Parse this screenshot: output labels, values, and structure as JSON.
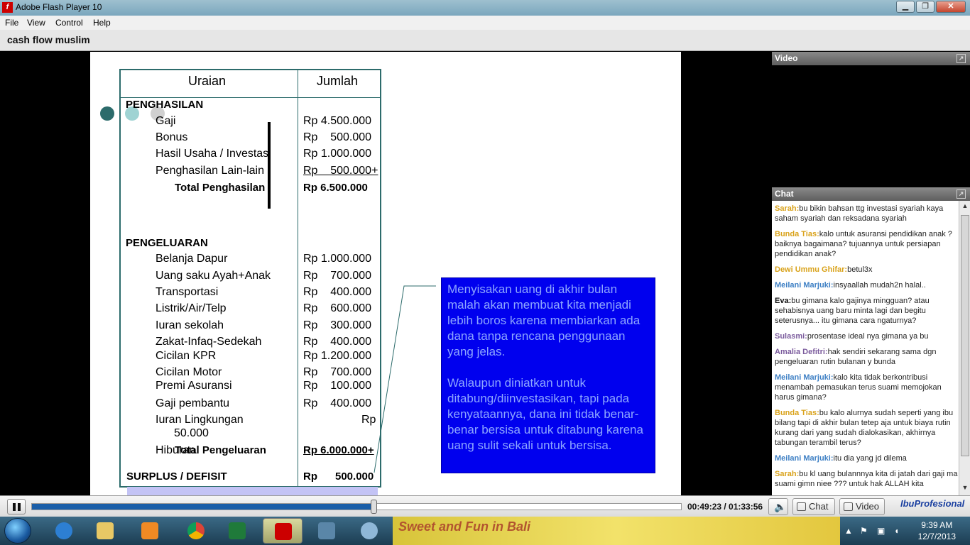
{
  "window": {
    "title": "Adobe Flash Player 10",
    "min": "▁",
    "max": "❐",
    "close": "✕"
  },
  "menu": [
    "File",
    "View",
    "Control",
    "Help"
  ],
  "app_title": "cash flow muslim",
  "table": {
    "head_uraian": "Uraian",
    "head_jumlah": "Jumlah",
    "income_header": "PENGHASILAN",
    "income": [
      {
        "label": "Gaji",
        "amount": "Rp 4.500.000"
      },
      {
        "label": "Bonus",
        "amount": "Rp    500.000"
      },
      {
        "label": "Hasil Usaha / Investasi",
        "amount": "Rp 1.000.000"
      },
      {
        "label": "Penghasilan Lain-lain",
        "amount": "Rp    500.000+"
      }
    ],
    "income_total_label": "Total Penghasilan",
    "income_total_amount": "Rp 6.500.000",
    "expense_header": "PENGELUARAN",
    "expenses": [
      {
        "label": "Belanja Dapur",
        "amount": "Rp 1.000.000"
      },
      {
        "label": "Uang saku Ayah+Anak",
        "amount": "Rp    700.000"
      },
      {
        "label": "Transportasi",
        "amount": "Rp    400.000"
      },
      {
        "label": "Listrik/Air/Telp",
        "amount": "Rp    600.000"
      },
      {
        "label": "Iuran sekolah",
        "amount": "Rp    300.000"
      },
      {
        "label": "Zakat-Infaq-Sedekah",
        "amount": "Rp    400.000"
      },
      {
        "label": "Cicilan KPR",
        "amount": "Rp 1.200.000"
      },
      {
        "label": "Cicilan Motor",
        "amount": "Rp    700.000"
      },
      {
        "label": "Premi Asuransi",
        "amount": "Rp    100.000"
      },
      {
        "label": "Gaji pembantu",
        "amount": "Rp    400.000"
      }
    ],
    "iuran_label": "Iuran Lingkungan",
    "iuran_amount": "Rp",
    "iuran_amount2": "50.000",
    "hiburan_label": "Hiburan",
    "expense_total_label": "Total Pengeluaran",
    "expense_total_amount": "Rp 6.000.000+",
    "surplus_label": "SURPLUS / DEFISIT",
    "surplus_amount": "Rp      500.000"
  },
  "note": {
    "p1": "Menyisakan uang di akhir bulan malah akan membuat kita menjadi lebih boros karena membiarkan ada dana tanpa rencana penggunaan yang jelas.",
    "p2": "Walaupun diniatkan untuk ditabung/diinvestasikan, tapi pada kenyataannya, dana ini tidak benar-benar bersisa untuk ditabung karena uang sulit sekali untuk bersisa."
  },
  "panels": {
    "video": "Video",
    "chat": "Chat"
  },
  "chat": [
    {
      "name": "Sarah:",
      "color": "#d9a21a",
      "text": "bu bikin bahsan ttg investasi syariah kaya saham syariah dan reksadana syariah"
    },
    {
      "name": "Bunda Tias:",
      "color": "#d9a21a",
      "text": "kalo untuk asuransi pendidikan anak ? baiknya bagaimana? tujuannya untuk persiapan pendidikan anak?"
    },
    {
      "name": "Dewi Ummu Ghifar:",
      "color": "#d9a21a",
      "text": "betul3x"
    },
    {
      "name": "Meilani Marjuki:",
      "color": "#3d7fc4",
      "text": "insyaallah mudah2n halal.."
    },
    {
      "name": "Eva:",
      "color": "#111111",
      "text": "bu gimana kalo gajinya mingguan? atau sehabisnya uang baru minta lagi dan begitu seterusnya... itu gimana cara ngaturnya?"
    },
    {
      "name": "Sulasmi:",
      "color": "#7a5a9c",
      "text": "prosentase ideal nya gimana ya bu"
    },
    {
      "name": "Amalia Defitri:",
      "color": "#7a5a9c",
      "text": "hak sendiri sekarang sama dgn pengeluaran rutin bulanan y bunda"
    },
    {
      "name": "Meilani Marjuki:",
      "color": "#3d7fc4",
      "text": "kalo kita tidak berkontribusi menambah pemasukan terus suami memojokan harus gimana?"
    },
    {
      "name": "Bunda Tias:",
      "color": "#d9a21a",
      "text": "bu kalo alurnya sudah seperti yang ibu bilang tapi di akhir bulan tetep aja untuk biaya rutin kurang dari yang sudah dialokasikan, akhirnya tabungan terambil terus?"
    },
    {
      "name": "Meilani Marjuki:",
      "color": "#3d7fc4",
      "text": "itu dia yang jd dilema"
    },
    {
      "name": "Sarah:",
      "color": "#d9a21a",
      "text": "bu kl uang bulannnya kita di jatah dari gaji ma suami gimn niee ??? untuk hak ALLAH kita"
    }
  ],
  "controls": {
    "time": "00:49:23 / 01:33:56",
    "chat_btn": "Chat",
    "video_btn": "Video",
    "brand": "IbuProfesional",
    "progress_fraction": 0.527
  },
  "taskbar": {
    "wallpaper_text": "Sweet and Fun in Bali",
    "time": "9:39 AM",
    "date": "12/7/2013"
  }
}
